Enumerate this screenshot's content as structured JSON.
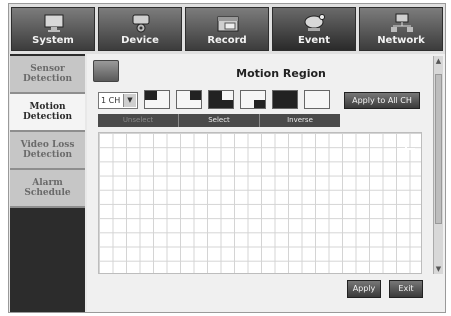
{
  "tabs": [
    {
      "label": "System",
      "icon": "monitor-icon"
    },
    {
      "label": "Device",
      "icon": "camera-icon"
    },
    {
      "label": "Record",
      "icon": "record-icon"
    },
    {
      "label": "Event",
      "icon": "alarm-camera-icon"
    },
    {
      "label": "Network",
      "icon": "network-icon"
    }
  ],
  "active_tab": "Event",
  "sidebar": {
    "items": [
      {
        "label": "Sensor\nDetection"
      },
      {
        "label": "Motion\nDetection"
      },
      {
        "label": "Video Loss\nDetection"
      },
      {
        "label": "Alarm\nSchedule"
      }
    ],
    "active": "Motion Detection"
  },
  "main": {
    "title": "Motion Region",
    "channel_select": {
      "value": "1 CH"
    },
    "apply_all_label": "Apply to All CH",
    "segments": [
      {
        "label": "Unselect"
      },
      {
        "label": "Select"
      },
      {
        "label": "Inverse"
      }
    ],
    "apply_label": "Apply",
    "exit_label": "Exit"
  },
  "colors": {
    "tab_bg": "#4a4a4a",
    "sidebar_bg": "#2c2c2c",
    "active_item": "#f4f4f4"
  }
}
